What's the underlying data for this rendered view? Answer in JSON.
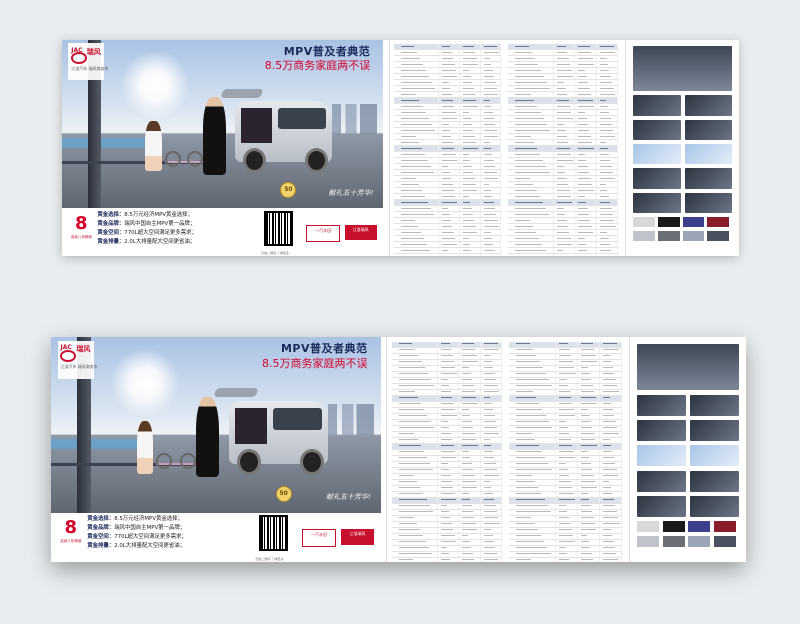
{
  "ad": {
    "brand_cn": "瑞风",
    "brand_en": "JAC",
    "brand_sub": "江淮汽车 瑞风商务车",
    "headline": "MPV普及者典范",
    "subhead": "8.5万商务家庭两不误",
    "slogan": "献礼五十芳华!",
    "badge": "50",
    "award_num": "8",
    "award_caption": "连续八年畅销",
    "features": [
      {
        "key": "黄金选择：",
        "text": "8.5万元经济MPV黄金选择；"
      },
      {
        "key": "黄金品牌：",
        "text": "瑞风中国自主MPV第一品牌；"
      },
      {
        "key": "黄金空间：",
        "text": "770L超大空间满足更多需求；"
      },
      {
        "key": "黄金排量：",
        "text": "2.0L大排量配大空间更省油；"
      }
    ],
    "qr_caption": "扫描二维码 了解更多",
    "dealer1": "一汽丰田",
    "dealer2": "江淮瑞风"
  },
  "colors": {
    "brand_red": "#c8102e",
    "headline_blue": "#1b2a5a",
    "subhead_red": "#d7002a",
    "table_header": "#dce2ec"
  },
  "icons": {
    "qr": "qr-code-icon",
    "badge": "anniversary-badge-icon",
    "logo": "jac-logo-icon"
  },
  "swatches": [
    "#d8d8d8",
    "#1a1a1a",
    "#3b3f8c",
    "#8a1d2b",
    "#bfc4cc",
    "#6b6e74",
    "#9aa6b8",
    "#4a5060"
  ]
}
